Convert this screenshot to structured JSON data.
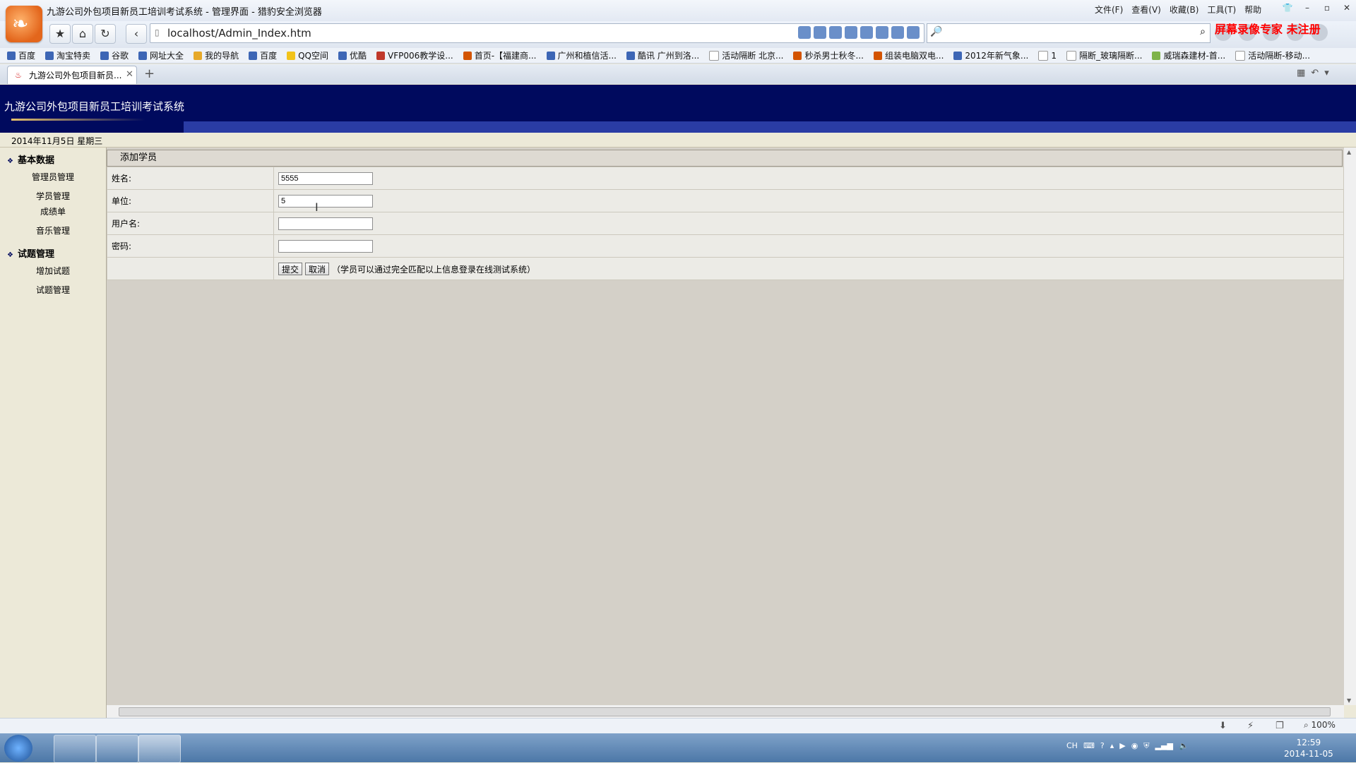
{
  "browser": {
    "window_title": "九游公司外包项目新员工培训考试系统 - 管理界面 - 猎豹安全浏览器",
    "menu": [
      "文件(F)",
      "查看(V)",
      "收藏(B)",
      "工具(T)",
      "帮助"
    ],
    "watermark": "屏幕录像专家 未注册",
    "url": "localhost/Admin_Index.htm",
    "bookmarks": [
      "百度",
      "淘宝特卖",
      "谷歌",
      "网址大全",
      "我的导航",
      "百度",
      "QQ空间",
      "优酷",
      "VFP006教学设...",
      "首页-【福建商...",
      "广州和植信活...",
      "酷讯 广州到洛...",
      "活动隔断 北京...",
      "秒杀男士秋冬...",
      "组装电脑双电...",
      "2012年新气象...",
      "1",
      "隔断_玻璃隔断...",
      "威瑞森建材-首...",
      "活动隔断-移动..."
    ],
    "tab_title": "九游公司外包项目新员...",
    "zoom": "100%"
  },
  "page": {
    "site_title": "九游公司外包项目新员工培训考试系统",
    "date": "2014年11月5日 星期三"
  },
  "sidebar": {
    "group1": "基本数据",
    "group1_items": [
      "管理员管理",
      "学员管理",
      "成绩单",
      "音乐管理"
    ],
    "group2": "试题管理",
    "group2_items": [
      "增加试题",
      "试题管理"
    ]
  },
  "form": {
    "heading": "添加学员",
    "name_label": "姓名:",
    "name_value": "5555",
    "unit_label": "单位:",
    "unit_value": "5",
    "username_label": "用户名:",
    "username_value": "",
    "password_label": "密码:",
    "password_value": "",
    "submit_label": "提交",
    "cancel_label": "取消",
    "hint": "（学员可以通过完全匹配以上信息登录在线测试系统）"
  },
  "taskbar": {
    "time": "12:59",
    "date": "2014-11-05",
    "lang": "CH"
  }
}
